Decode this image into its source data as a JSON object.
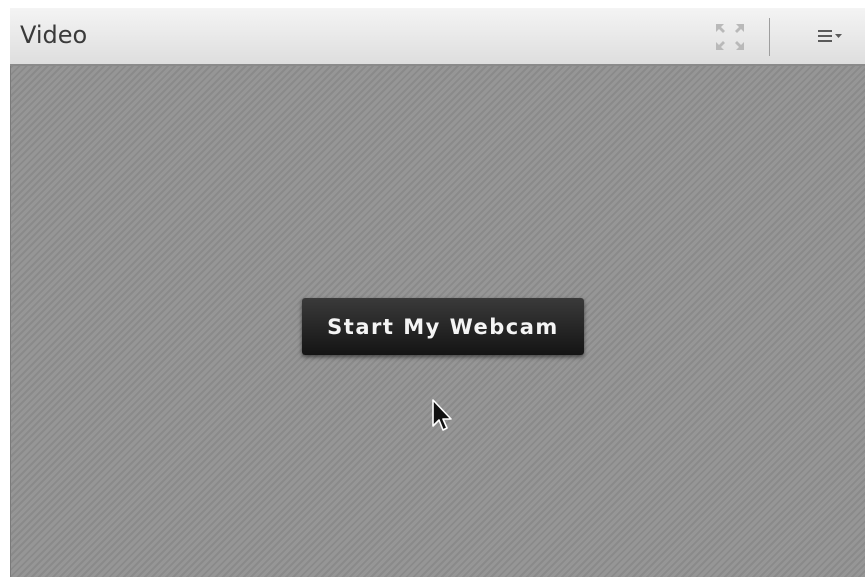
{
  "pod": {
    "title": "Video",
    "fullscreen_icon": "expand-arrows-icon",
    "menu_icon": "pod-options-menu-icon"
  },
  "video": {
    "start_button_label": "Start My Webcam"
  },
  "colors": {
    "header_top": "#f4f4f4",
    "header_bottom": "#dedede",
    "video_bg": "#8f8f8f",
    "button_bg": "#1e1e1e",
    "button_text": "#f4f4f4"
  }
}
